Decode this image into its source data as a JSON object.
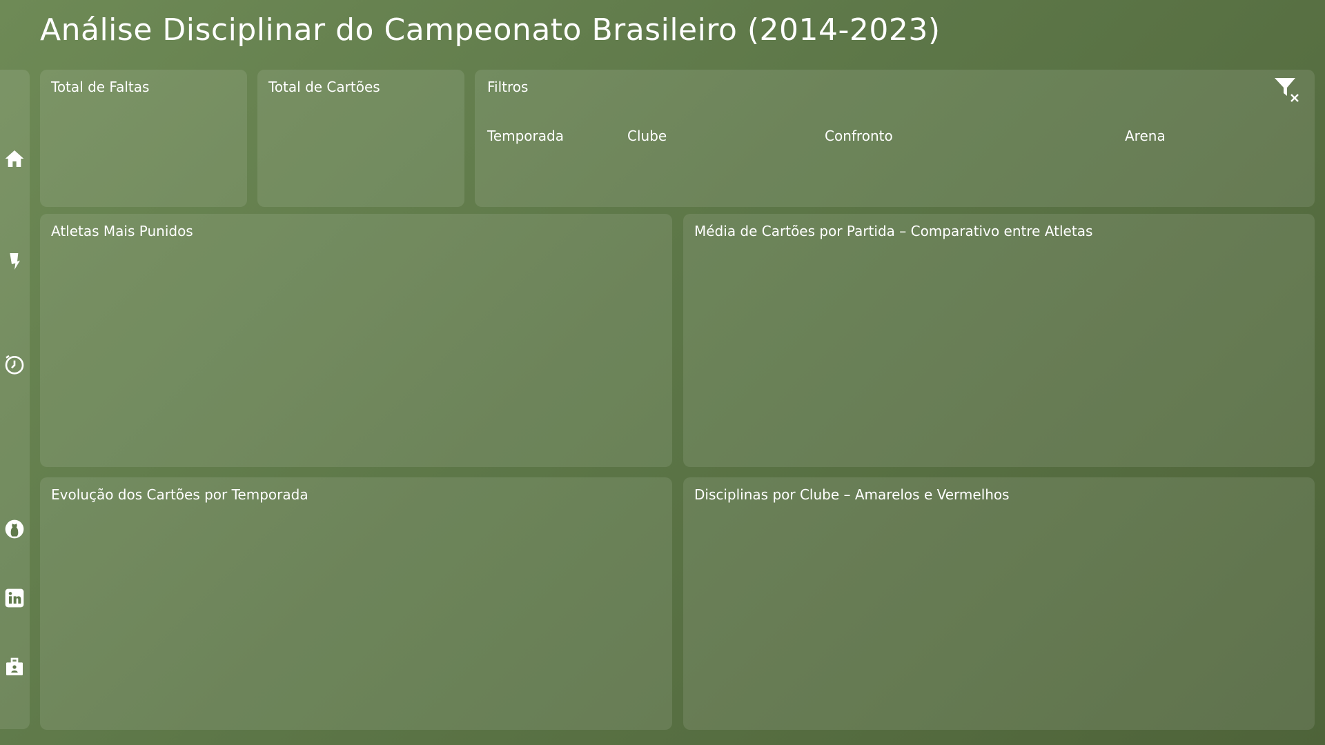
{
  "title": "Análise Disciplinar do Campeonato Brasileiro (2014-2023)",
  "sidebar": {
    "icons": [
      "home-icon",
      "bookmark-icon",
      "clock-icon",
      "github-icon",
      "linkedin-icon",
      "portfolio-icon"
    ]
  },
  "kpis": {
    "faltas_title": "Total de Faltas",
    "cartoes_title": "Total de Cartões"
  },
  "filters": {
    "title": "Filtros",
    "temporada": "Temporada",
    "clube": "Clube",
    "confronto": "Confronto",
    "arena": "Arena",
    "clear_icon": "clear-filter-icon"
  },
  "charts": {
    "atletas_title": "Atletas Mais Punidos",
    "media_title": "Média de Cartões por Partida – Comparativo entre Atletas",
    "evolucao_title": "Evolução dos Cartões por Temporada",
    "disciplinas_title": "Disciplinas por Clube – Amarelos e Vermelhos"
  }
}
